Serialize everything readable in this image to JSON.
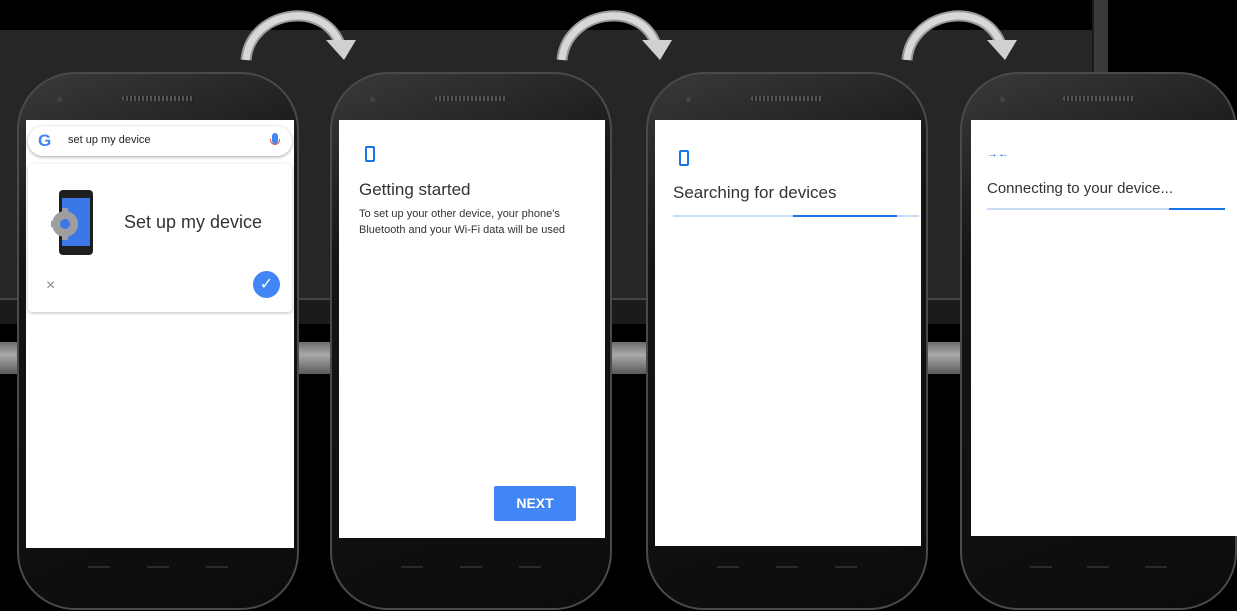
{
  "step1": {
    "search_query": "set up my device",
    "card_title": "Set up my device",
    "google_logo": "G"
  },
  "step2": {
    "title": "Getting started",
    "body": "To set up your other device, your phone's Bluetooth and your Wi-Fi data will be used",
    "next_label": "NEXT"
  },
  "step3": {
    "title": "Searching for devices"
  },
  "step4": {
    "title": "Connecting to your device..."
  },
  "icons": {
    "close": "×",
    "check": "✓",
    "swap": "→←"
  },
  "colors": {
    "accent": "#4285f4",
    "backdrop": "#262626"
  }
}
